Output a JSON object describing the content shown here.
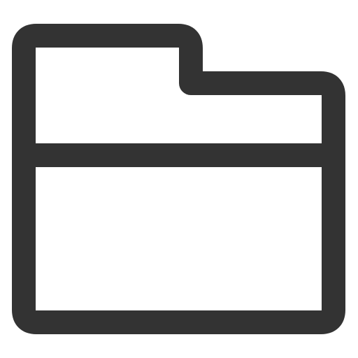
{
  "icon": {
    "name": "folder-icon",
    "stroke_color": "#333333",
    "fill_color": "#ffffff",
    "background_color": "#ffffff"
  }
}
